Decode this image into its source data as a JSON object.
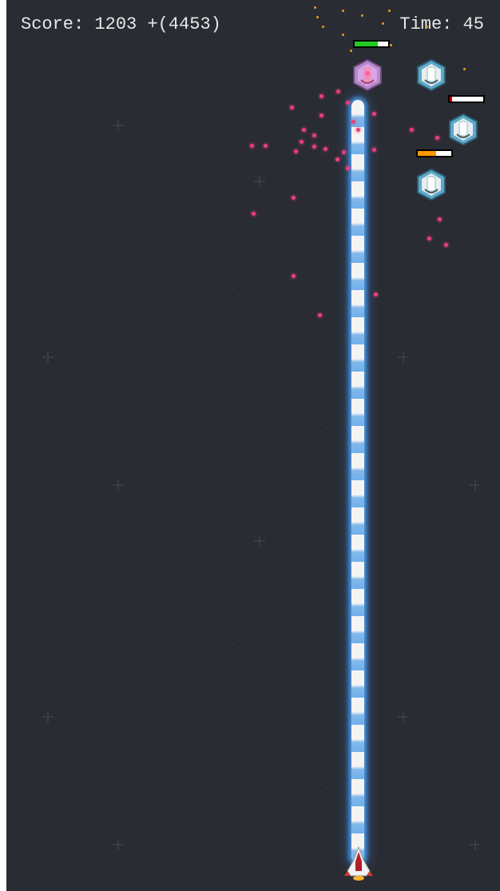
{
  "hud": {
    "score_label": "Score:",
    "score_value": "1203",
    "score_bonus": "+(4453)",
    "time_label": "Time:",
    "time_value": "45"
  },
  "colors": {
    "background": "#2a2c33",
    "beam_glow": "#4fa8ff",
    "health_green": "#22cc22",
    "health_orange": "#ff9900",
    "health_red": "#cc0000",
    "particle_pink": "#e8407a",
    "particle_orange": "#e8a020"
  },
  "enemies": [
    {
      "name": "enemy-ship-targeted",
      "variant": "pink",
      "health_fraction": 0.7,
      "health_color": "#22cc22"
    },
    {
      "name": "enemy-ship-1",
      "variant": "blue",
      "health_fraction": null
    },
    {
      "name": "enemy-ship-2",
      "variant": "blue",
      "health_fraction": 0.05,
      "health_color": "#cc0000"
    },
    {
      "name": "enemy-ship-3",
      "variant": "blue",
      "health_fraction": 0.55,
      "health_color": "#ff9900"
    }
  ],
  "player": {
    "icon": "rocket-ship-icon"
  }
}
